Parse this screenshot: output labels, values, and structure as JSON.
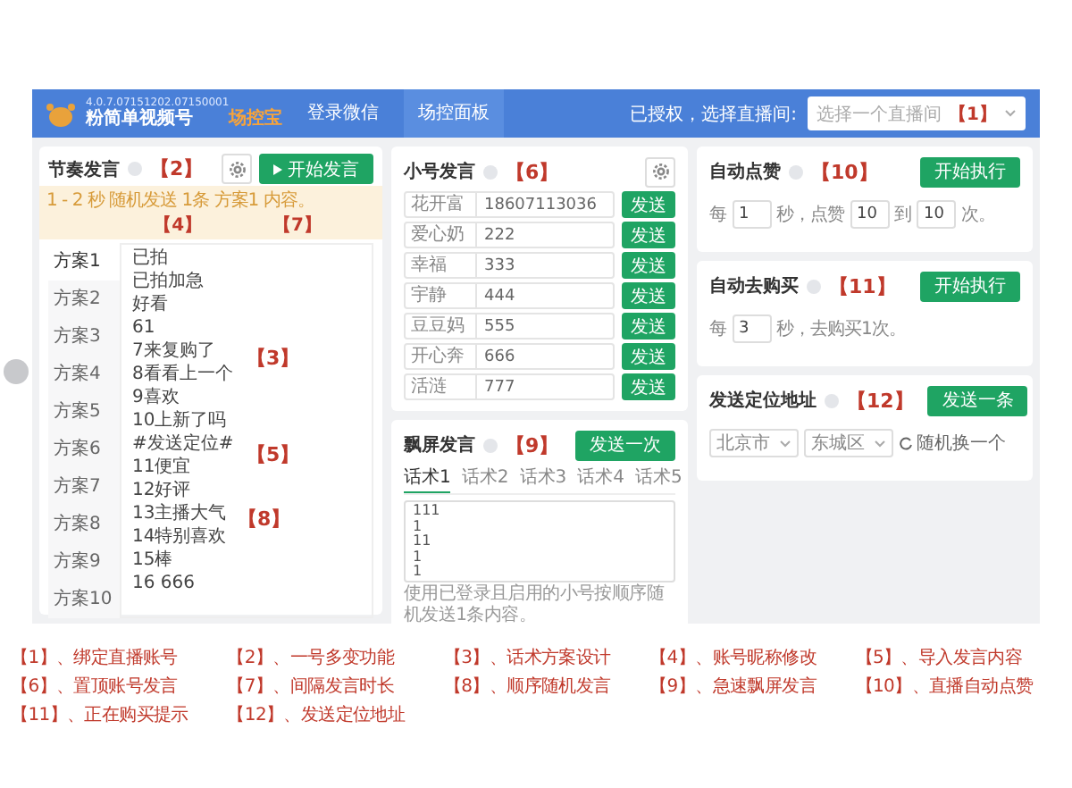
{
  "header": {
    "version": "4.0.7.07151202.07150001",
    "app_name": "粉简单视频号",
    "app_badge": "场控宝",
    "nav": [
      {
        "label": "登录微信",
        "selected": false
      },
      {
        "label": "场控面板",
        "selected": true
      }
    ],
    "room_label": "已授权，选择直播间:",
    "room_select": {
      "placeholder": "选择一个直播间"
    },
    "annotation": "【1】"
  },
  "rhythm": {
    "title": "节奏发言",
    "annotation": "【2】",
    "start_button": "开始发言",
    "hint": "1 - 2 秒 随机发送 1条 方案1 内容。",
    "hint_annotations": [
      "【4】",
      "【7】"
    ],
    "plans": [
      {
        "label": "方案1",
        "selected": true
      },
      {
        "label": "方案2",
        "selected": false
      },
      {
        "label": "方案3",
        "selected": false
      },
      {
        "label": "方案4",
        "selected": false
      },
      {
        "label": "方案5",
        "selected": false
      },
      {
        "label": "方案6",
        "selected": false
      },
      {
        "label": "方案7",
        "selected": false
      },
      {
        "label": "方案8",
        "selected": false
      },
      {
        "label": "方案9",
        "selected": false
      },
      {
        "label": "方案10",
        "selected": false
      }
    ],
    "lines": [
      "已拍",
      "已拍加急",
      "好看",
      "61",
      "7来复购了",
      "8看看上一个",
      "9喜欢",
      "10上新了吗",
      "#发送定位#",
      "11便宜",
      "12好评",
      "13主播大气",
      "14特别喜欢",
      "15棒",
      "16 666"
    ],
    "list_annotations": [
      "【3】",
      "【5】",
      "【8】"
    ]
  },
  "accounts": {
    "title": "小号发言",
    "annotation": "【6】",
    "rows": [
      {
        "name": "花开富",
        "value": "18607113036",
        "button": "发送"
      },
      {
        "name": "爱心奶",
        "value": "222",
        "button": "发送"
      },
      {
        "name": "幸福",
        "value": "333",
        "button": "发送"
      },
      {
        "name": "宇静",
        "value": "444",
        "button": "发送"
      },
      {
        "name": "豆豆妈",
        "value": "555",
        "button": "发送"
      },
      {
        "name": "开心奔",
        "value": "666",
        "button": "发送"
      },
      {
        "name": "活涟",
        "value": "777",
        "button": "发送"
      }
    ]
  },
  "float_msg": {
    "title": "飘屏发言",
    "annotation": "【9】",
    "button": "发送一次",
    "tabs": [
      {
        "label": "话术1",
        "selected": true
      },
      {
        "label": "话术2",
        "selected": false
      },
      {
        "label": "话术3",
        "selected": false
      },
      {
        "label": "话术4",
        "selected": false
      },
      {
        "label": "话术5",
        "selected": false
      }
    ],
    "text": "111\n1\n11\n1\n1",
    "footer": "使用已登录且启用的小号按顺序随机发送1条内容。"
  },
  "auto_like": {
    "title": "自动点赞",
    "annotation": "【10】",
    "button": "开始执行",
    "parts": [
      {
        "kind": "text",
        "text": "每"
      },
      {
        "kind": "input",
        "text": "1"
      },
      {
        "kind": "text",
        "text": "秒，点赞"
      },
      {
        "kind": "input",
        "text": "10"
      },
      {
        "kind": "text",
        "text": "到"
      },
      {
        "kind": "input",
        "text": "10"
      },
      {
        "kind": "text",
        "text": "次。"
      }
    ]
  },
  "auto_buy": {
    "title": "自动去购买",
    "annotation": "【11】",
    "button": "开始执行",
    "parts": [
      {
        "kind": "text",
        "text": "每"
      },
      {
        "kind": "input",
        "text": "3"
      },
      {
        "kind": "text",
        "text": "秒，去购买1次。"
      }
    ]
  },
  "location": {
    "title": "发送定位地址",
    "annotation": "【12】",
    "button": "发送一条",
    "city": "北京市",
    "district": "东城区",
    "random": "随机换一个"
  },
  "legend": [
    "【1】、绑定直播账号",
    "【2】、一号多变功能",
    "【3】、话术方案设计",
    "【4】、账号昵称修改",
    "【5】、导入发言内容",
    "【6】、置顶账号发言",
    "【7】、间隔发言时长",
    "【8】、顺序随机发言",
    "【9】、急速飘屏发言",
    "【10】、直播自动点赞",
    "【11】、正在购买提示",
    "【12】、发送定位地址"
  ]
}
